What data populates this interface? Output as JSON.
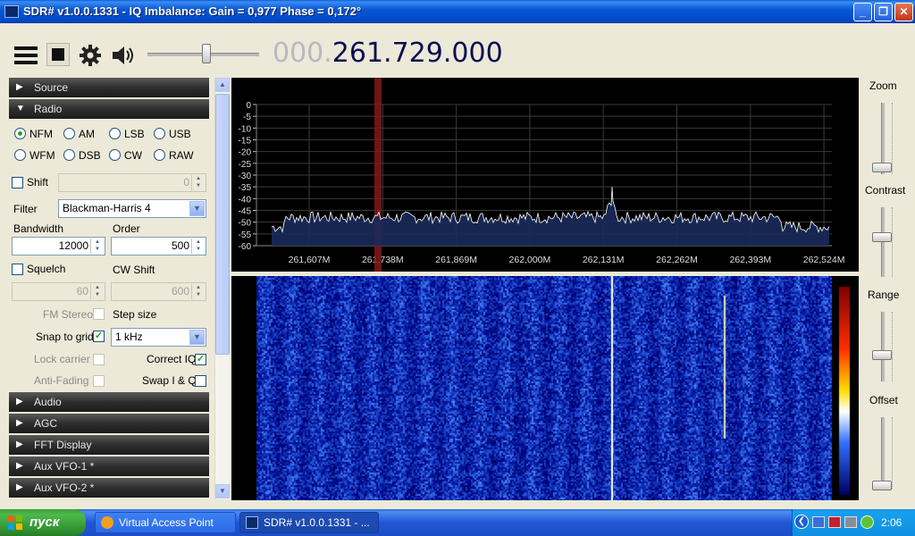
{
  "window": {
    "title": "SDR# v1.0.0.1331 - IQ Imbalance: Gain = 0,977 Phase = 0,172°",
    "minimize": "_",
    "maximize": "❐",
    "close": "✕"
  },
  "toolbar": {
    "frequency_prefix": "000.",
    "frequency_main": "261.729.000",
    "volume_fraction": 0.53
  },
  "left_panel": {
    "sections_top": [
      {
        "label": "Source",
        "expanded": false
      },
      {
        "label": "Radio",
        "expanded": true
      }
    ],
    "modes": [
      "NFM",
      "AM",
      "LSB",
      "USB",
      "WFM",
      "DSB",
      "CW",
      "RAW"
    ],
    "selected_mode": "NFM",
    "shift_label": "Shift",
    "shift_value": "0",
    "filter_label": "Filter",
    "filter_value": "Blackman-Harris 4",
    "bandwidth_label": "Bandwidth",
    "bandwidth_value": "12000",
    "order_label": "Order",
    "order_value": "500",
    "squelch_label": "Squelch",
    "cw_shift_label": "CW Shift",
    "squelch_value": "60",
    "cw_shift_value": "600",
    "fm_stereo_label": "FM Stereo",
    "step_size_label": "Step size",
    "snap_label": "Snap to grid",
    "snap_checked": true,
    "step_value": "1 kHz",
    "lock_carrier_label": "Lock carrier",
    "correct_iq_label": "Correct IQ",
    "correct_iq_checked": true,
    "anti_fading_label": "Anti-Fading",
    "swap_iq_label": "Swap I & Q",
    "sections_bottom": [
      "Audio",
      "AGC",
      "FFT Display",
      "Aux VFO-1 *",
      "Aux VFO-2 *"
    ]
  },
  "spectrum": {
    "y_ticks": [
      "0",
      "-5",
      "-10",
      "-15",
      "-20",
      "-25",
      "-30",
      "-35",
      "-40",
      "-45",
      "-50",
      "-55",
      "-60"
    ],
    "x_ticks": [
      "261,607M",
      "261,738M",
      "261,869M",
      "262,000M",
      "262,131M",
      "262,262M",
      "262,393M",
      "262,524M"
    ],
    "colors": {
      "trace": "#ffffff",
      "fill": "#1a2a5a",
      "grid": "#3a3a3a",
      "vfo": "#8a1a1a"
    }
  },
  "right_panel": {
    "zoom_label": "Zoom",
    "contrast_label": "Contrast",
    "range_label": "Range",
    "offset_label": "Offset"
  },
  "taskbar": {
    "start_label": "пуск",
    "tasks": [
      {
        "label": "Virtual Access Point",
        "active": false
      },
      {
        "label": "SDR# v1.0.0.1331 - ...",
        "active": true
      }
    ],
    "clock": "2:06"
  }
}
